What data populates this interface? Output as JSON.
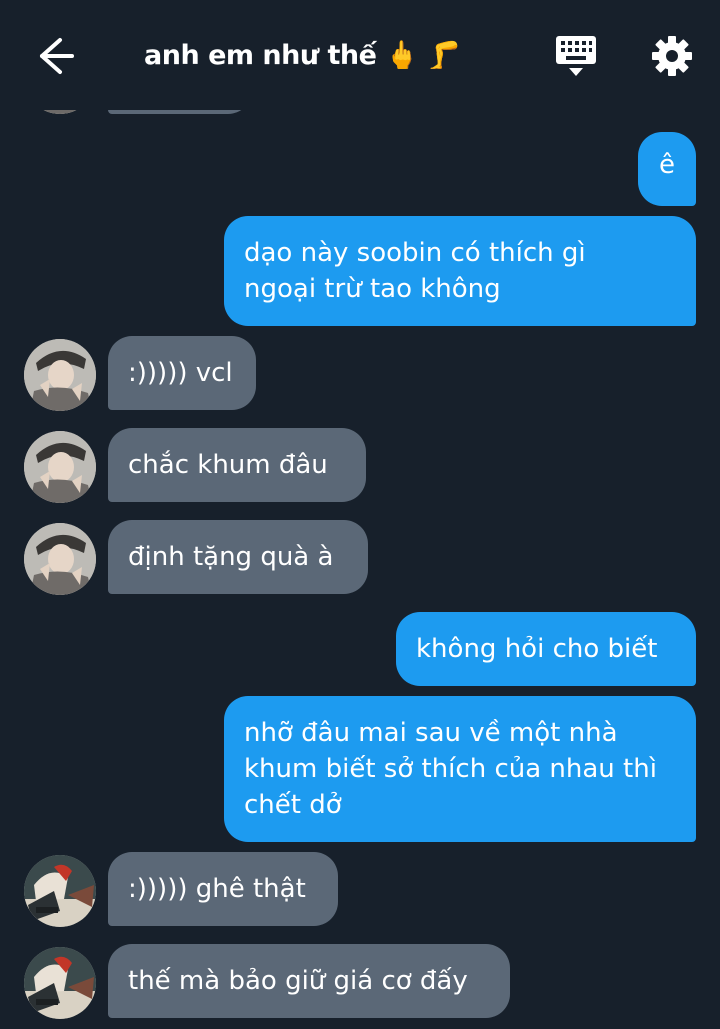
{
  "header": {
    "title": "anh em như thế 🖕 🦵",
    "back_icon": "arrow-left-icon",
    "keyboard_icon": "keyboard-icon",
    "settings_icon": "gear-icon"
  },
  "colors": {
    "background": "#17202b",
    "outgoing_bubble": "#1d9bf0",
    "incoming_bubble": "#5b6877",
    "text": "#ffffff"
  },
  "messages": [
    {
      "direction": "in",
      "text": ""
    },
    {
      "direction": "out",
      "text": "ê"
    },
    {
      "direction": "out",
      "text": "dạo này soobin có thích gì\nngoại trừ tao không"
    },
    {
      "direction": "in",
      "text": ":))))) vcl"
    },
    {
      "direction": "in",
      "text": "chắc khum đâu"
    },
    {
      "direction": "in",
      "text": "định tặng quà à"
    },
    {
      "direction": "out",
      "text": "không hỏi cho biết"
    },
    {
      "direction": "out",
      "text": "nhỡ đâu mai sau về một nhà\nkhum biết sở thích của nhau thì\nchết dở"
    },
    {
      "direction": "in",
      "text": ":))))) ghê thật"
    },
    {
      "direction": "in",
      "text": "thế mà bảo giữ giá cơ đấy"
    }
  ]
}
